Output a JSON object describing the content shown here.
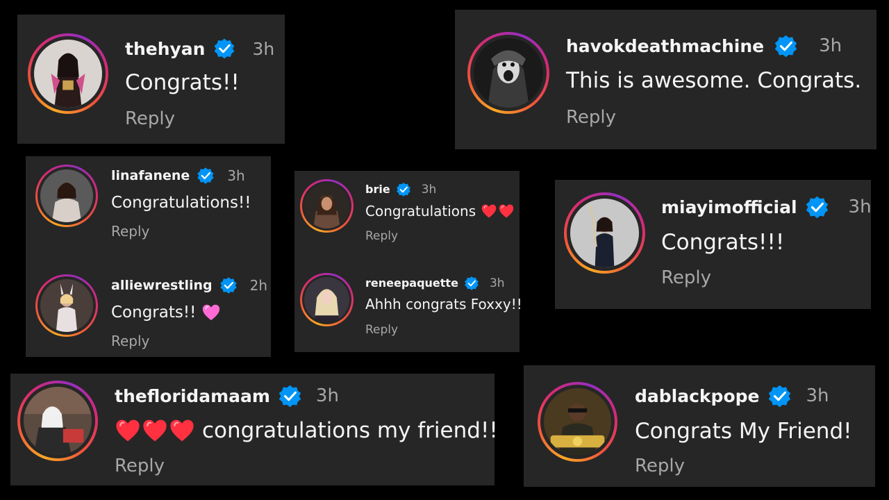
{
  "colors": {
    "background": "#000000",
    "card": "#262626",
    "text": "#f5f5f5",
    "muted": "#a8a8a8",
    "verified": "#0095f6",
    "heart_red": "#ff3040",
    "heart_pink": "#ff6ad5"
  },
  "icons": {
    "verified": "verified-badge-icon",
    "red_heart": "red-heart-emoji",
    "pink_heart": "pink-heart-emoji"
  },
  "comments": {
    "thehyan": {
      "username": "thehyan",
      "time": "3h",
      "text": "Congrats!!",
      "reply": "Reply"
    },
    "havok": {
      "username": "havokdeathmachine",
      "time": "3h",
      "text": "This is awesome. Congrats.",
      "reply": "Reply"
    },
    "linafanene": {
      "username": "linafanene",
      "time": "3h",
      "text": "Congratulations!!",
      "reply": "Reply"
    },
    "alliewrestling": {
      "username": "alliewrestling",
      "time": "2h",
      "text": "Congrats!!",
      "reply": "Reply"
    },
    "brie": {
      "username": "brie",
      "time": "3h",
      "text": "Congratulations",
      "reply": "Reply"
    },
    "reneepaquette": {
      "username": "reneepaquette",
      "time": "3h",
      "text": "Ahhh congrats Foxxy!!",
      "reply": "Reply"
    },
    "miayim": {
      "username": "miayimofficial",
      "time": "3h",
      "text": "Congrats!!!",
      "reply": "Reply"
    },
    "floridamaam": {
      "username": "thefloridamaam",
      "time": "3h",
      "text": "congratulations my friend!!",
      "reply": "Reply"
    },
    "dablackpope": {
      "username": "dablackpope",
      "time": "3h",
      "text": "Congrats My Friend!",
      "reply": "Reply"
    }
  }
}
